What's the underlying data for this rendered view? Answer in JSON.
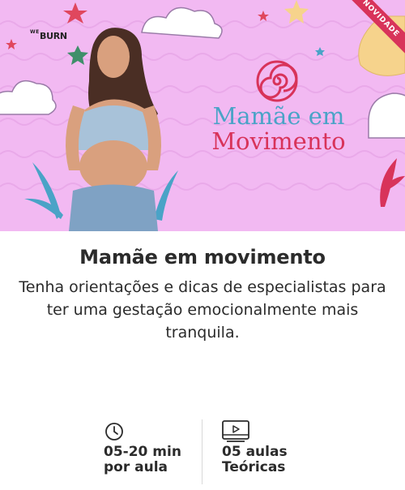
{
  "banner": {
    "brand_top": "WE",
    "brand_main": "BURN",
    "ribbon": "NOVIDADE",
    "logo_line1": "Mamãe em",
    "logo_line2": "Movimento",
    "colors": {
      "background": "#f2b9f2",
      "accent_blue": "#4aa3c7",
      "accent_red": "#d8335a"
    }
  },
  "course": {
    "title": "Mamãe em movimento",
    "description": "Tenha orientações e dicas de especialistas para ter uma gestação emocionalmente mais tranquila."
  },
  "meta": {
    "duration": {
      "icon": "clock-icon",
      "line1": "05-20 min",
      "line2": "por aula"
    },
    "lessons": {
      "icon": "video-icon",
      "line1": "05 aulas",
      "line2": "Teóricas"
    }
  }
}
